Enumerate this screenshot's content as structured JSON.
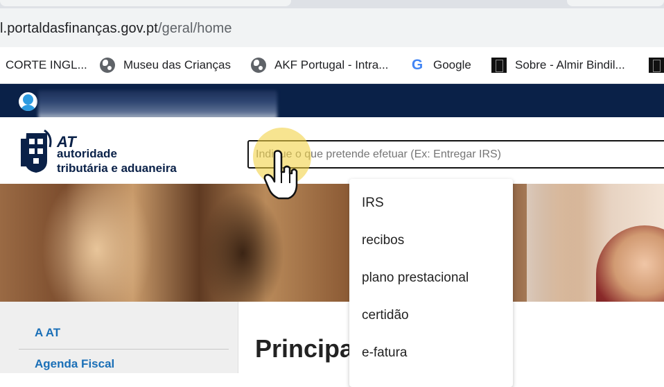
{
  "browser": {
    "url_host": "l.portaldasfinanças.gov.pt",
    "url_path": "/geral/home",
    "bookmarks": [
      {
        "label": "CORTE INGL...",
        "icon": "none"
      },
      {
        "label": "Museu das Crianças",
        "icon": "globe-icon"
      },
      {
        "label": "AKF Portugal - Intra...",
        "icon": "globe-icon"
      },
      {
        "label": "Google",
        "icon": "google-icon"
      },
      {
        "label": "Sobre - Almir Bindil...",
        "icon": "site-icon"
      }
    ]
  },
  "header": {
    "logo_at": "AT",
    "logo_line1": "autoridade",
    "logo_line2": "tributária e aduaneira",
    "search_placeholder": "Indique o que pretende efetuar (Ex: Entregar IRS)"
  },
  "suggestions": [
    "IRS",
    "recibos",
    "plano prestacional",
    "certidão",
    "e-fatura"
  ],
  "sidebar": {
    "items": [
      "A AT",
      "Agenda Fiscal"
    ]
  },
  "main": {
    "title": "Principa"
  },
  "colors": {
    "top_strip": "#0a2148",
    "link_blue": "#1a6fb7",
    "cursor_highlight": "#f2d246"
  }
}
